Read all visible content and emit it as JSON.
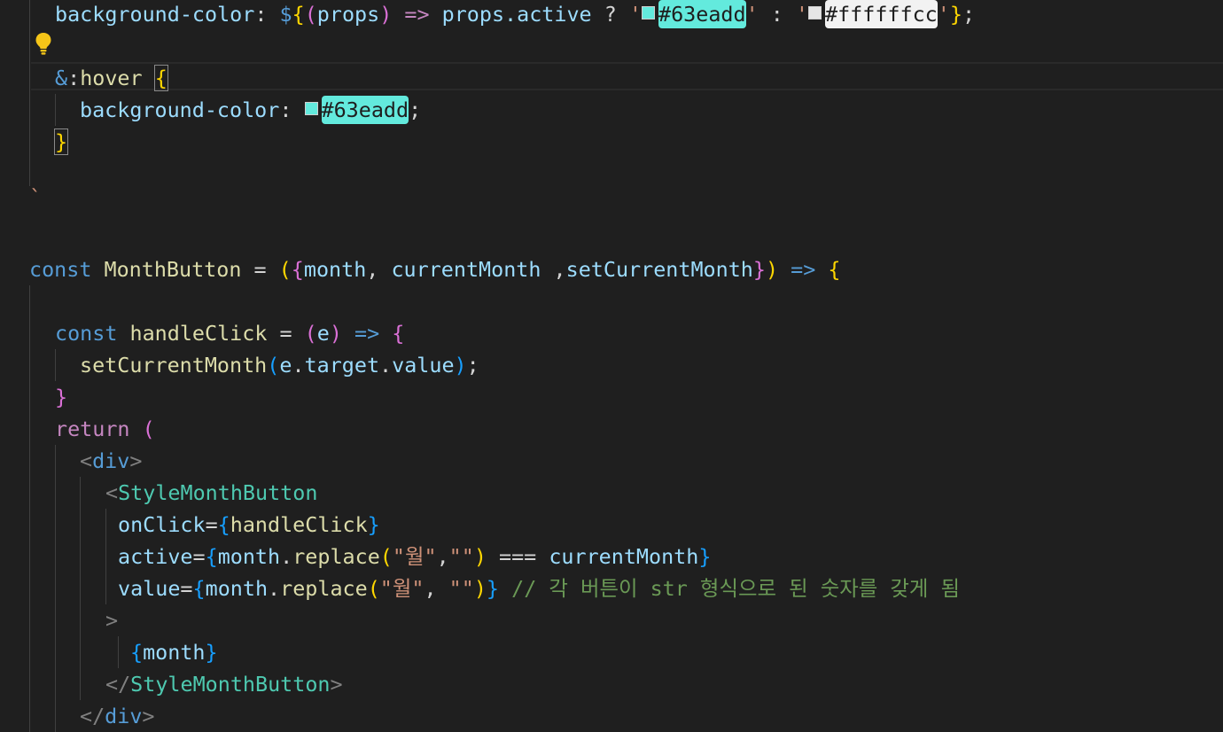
{
  "editor": {
    "language": "javascript (styled-components / JSX)",
    "active_color_hex": "#63eadd",
    "inactive_color_hex": "#ffffffcc",
    "lines": {
      "l1": {
        "t1": "background-color",
        "t2": ": ",
        "t3": "$",
        "t4": "{",
        "t5": "(",
        "t6": "props",
        "t7": ")",
        "t8": " => ",
        "t9": "props.active",
        "t10": " ? ",
        "t11": "'",
        "t12": "#63eadd",
        "t13": "'",
        "t14": " : ",
        "t15": "'",
        "t16": "#ffffffcc",
        "t17": "'",
        "t18": "}",
        "t19": ";"
      },
      "l3": {
        "t1": "&",
        "t2": ":",
        "t3": "hover",
        "t4": " ",
        "t5": "{"
      },
      "l4": {
        "t1": "background-color",
        "t2": ": ",
        "t3": "#63eadd",
        "t4": ";"
      },
      "l5": {
        "t1": "}"
      },
      "l7": {
        "t1": "`"
      },
      "l9": {
        "t1": "const",
        "t2": " ",
        "t3": "MonthButton",
        "t4": " = ",
        "t5": "(",
        "t6": "{",
        "t7": "month",
        "t8": ", ",
        "t9": "currentMonth",
        "t10": " ,",
        "t11": "setCurrentMonth",
        "t12": "}",
        "t13": ")",
        "t14": " => ",
        "t15": "{"
      },
      "l11": {
        "t1": "const",
        "t2": " ",
        "t3": "handleClick",
        "t4": " = ",
        "t5": "(",
        "t6": "e",
        "t7": ")",
        "t8": " => ",
        "t9": "{"
      },
      "l12": {
        "t1": "setCurrentMonth",
        "t2": "(",
        "t3": "e",
        "t4": ".",
        "t5": "target",
        "t6": ".",
        "t7": "value",
        "t8": ")",
        "t9": ";"
      },
      "l13": {
        "t1": "}"
      },
      "l14": {
        "t1": "return",
        "t2": " ",
        "t3": "("
      },
      "l15": {
        "t1": "<",
        "t2": "div",
        "t3": ">"
      },
      "l16": {
        "t1": "<",
        "t2": "StyleMonthButton"
      },
      "l17": {
        "t1": "onClick",
        "t2": "=",
        "t3": "{",
        "t4": "handleClick",
        "t5": "}"
      },
      "l18": {
        "t1": "active",
        "t2": "=",
        "t3": "{",
        "t4": "month",
        "t5": ".",
        "t6": "replace",
        "t7": "(",
        "t8": "\"월\"",
        "t9": ",",
        "t10": "\"\"",
        "t11": ")",
        "t12": " === ",
        "t13": "currentMonth",
        "t14": "}"
      },
      "l19": {
        "t1": "value",
        "t2": "=",
        "t3": "{",
        "t4": "month",
        "t5": ".",
        "t6": "replace",
        "t7": "(",
        "t8": "\"월\"",
        "t9": ", ",
        "t10": "\"\"",
        "t11": ")",
        "t12": "}",
        "t13": " ",
        "t14": "// 각 버튼이 str 형식으로 된 숫자를 갖게 됨"
      },
      "l20": {
        "t1": ">"
      },
      "l21": {
        "t1": "{",
        "t2": "month",
        "t3": "}"
      },
      "l22": {
        "t1": "</",
        "t2": "StyleMonthButton",
        "t3": ">"
      },
      "l23": {
        "t1": "</",
        "t2": "div",
        "t3": ">"
      }
    }
  }
}
